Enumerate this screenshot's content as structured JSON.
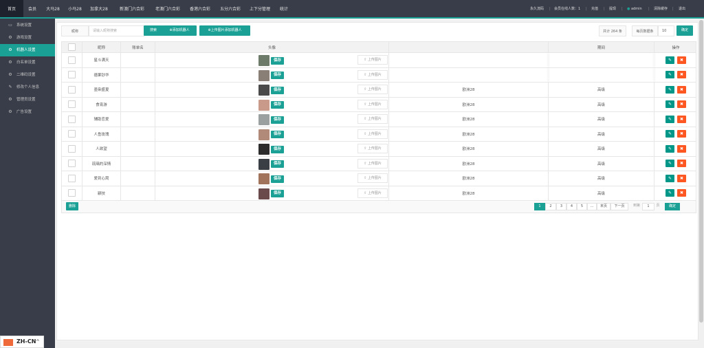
{
  "topnav": {
    "items": [
      "首页",
      "会员",
      "大马28",
      "小马28",
      "加拿大28",
      "新澳门六合彩",
      "老澳门六合彩",
      "香港六合彩",
      "五分六合彩",
      "上下分管理",
      "统计"
    ],
    "right": {
      "forever_code": "永久流码",
      "online_label": "会员在线人数：1",
      "notify": "充值",
      "withdraw": "提现",
      "user": "admin",
      "clear_cache": "清除缓存",
      "logout": "退出"
    }
  },
  "sidebar": {
    "items": [
      {
        "icon": "monitor-icon",
        "label": "系统设置"
      },
      {
        "icon": "gear-icon",
        "label": "游戏设置"
      },
      {
        "icon": "gear-icon",
        "label": "机器人设置"
      },
      {
        "icon": "gear-icon",
        "label": "白名单设置"
      },
      {
        "icon": "gear-icon",
        "label": "二维码设置"
      },
      {
        "icon": "pencil-icon",
        "label": "修改个人信息"
      },
      {
        "icon": "gear-icon",
        "label": "管理员设置"
      },
      {
        "icon": "gear-icon",
        "label": "广告设置"
      }
    ],
    "active_index": 2
  },
  "toolbar": {
    "nickname_label": "昵称",
    "search_placeholder": "请输入昵称搜索",
    "search_button": "搜索",
    "add_robot_button": "添加机器人",
    "upload_add_button": "上传图片添加机器人",
    "total_label": "共计 264 条",
    "per_page_label": "每页数据条",
    "per_page_value": "10",
    "confirm_button": "确定"
  },
  "table": {
    "headers": [
      "",
      "昵称",
      "账单名",
      "头像",
      "",
      "",
      "操作"
    ],
    "header_game": "",
    "header_time": "期间",
    "upload_label": "上传图片",
    "save_label": "保存",
    "rows": [
      {
        "nickname": "星斗满天",
        "game": "",
        "status": "",
        "blurred": true
      },
      {
        "nickname": "德果钞华",
        "game": "",
        "status": "",
        "blurred": true
      },
      {
        "nickname": "墨染盛夏",
        "game": "欧洲28",
        "status": "高级",
        "blurred": false
      },
      {
        "nickname": "食宵游",
        "game": "欧洲28",
        "status": "高级",
        "blurred": false
      },
      {
        "nickname": "辅助恋爱",
        "game": "欧洲28",
        "status": "高级",
        "blurred": false
      },
      {
        "nickname": "人鱼玫瑰",
        "game": "欧洲28",
        "status": "高级",
        "blurred": false
      },
      {
        "nickname": "人欲望",
        "game": "欧洲28",
        "status": "高级",
        "blurred": false
      },
      {
        "nickname": "琉璃的深情",
        "game": "欧洲28",
        "status": "高级",
        "blurred": false
      },
      {
        "nickname": "爱到心窝",
        "game": "欧洲28",
        "status": "高级",
        "blurred": false
      },
      {
        "nickname": "颛技",
        "game": "欧洲28",
        "status": "高级",
        "blurred": false
      }
    ],
    "avatar_colors": [
      "#6d7b6a",
      "#8a7f77",
      "#4a4a4a",
      "#c99a8a",
      "#9aa0a0",
      "#b28a7a",
      "#2c2c2c",
      "#3a3f46",
      "#a0735a",
      "#6a4a4a"
    ],
    "delete_button": "删除"
  },
  "pager": {
    "pages": [
      "1",
      "2",
      "3",
      "4",
      "5",
      "...",
      "末页",
      "下一页"
    ],
    "goto_label": "到第",
    "goto_value": "1",
    "page_suffix": "页",
    "confirm": "确定"
  },
  "lang": {
    "code": "ZH-CN"
  }
}
